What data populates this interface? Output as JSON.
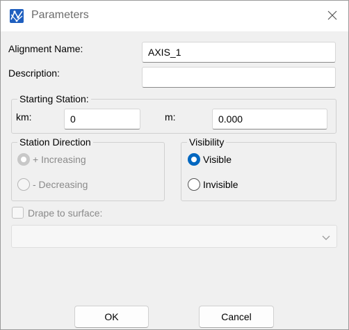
{
  "window": {
    "title": "Parameters",
    "close_glyph": "✕"
  },
  "form": {
    "alignment_name_label": "Alignment Name:",
    "alignment_name_value": "AXIS_1",
    "description_label": "Description:",
    "description_value": ""
  },
  "starting_station": {
    "title": "Starting Station:",
    "km_label": "km:",
    "km_value": "0",
    "m_label": "m:",
    "m_value": "0.000"
  },
  "station_direction": {
    "title": "Station Direction",
    "options": [
      {
        "label": "+ Increasing",
        "selected": true,
        "enabled": false
      },
      {
        "label": "- Decreasing",
        "selected": false,
        "enabled": false
      }
    ]
  },
  "visibility": {
    "title": "Visibility",
    "options": [
      {
        "label": "Visible",
        "selected": true,
        "enabled": true
      },
      {
        "label": "Invisible",
        "selected": false,
        "enabled": true
      }
    ]
  },
  "drape": {
    "label": "Drape to surface:",
    "checked": false,
    "enabled": false,
    "surface_value": ""
  },
  "buttons": {
    "ok": "OK",
    "cancel": "Cancel"
  },
  "colors": {
    "accent": "#0067c0",
    "app_icon": "#1f5fbf"
  },
  "icons": {
    "app": "network-app-icon",
    "close": "close-icon",
    "dropdown": "chevron-down-icon"
  }
}
